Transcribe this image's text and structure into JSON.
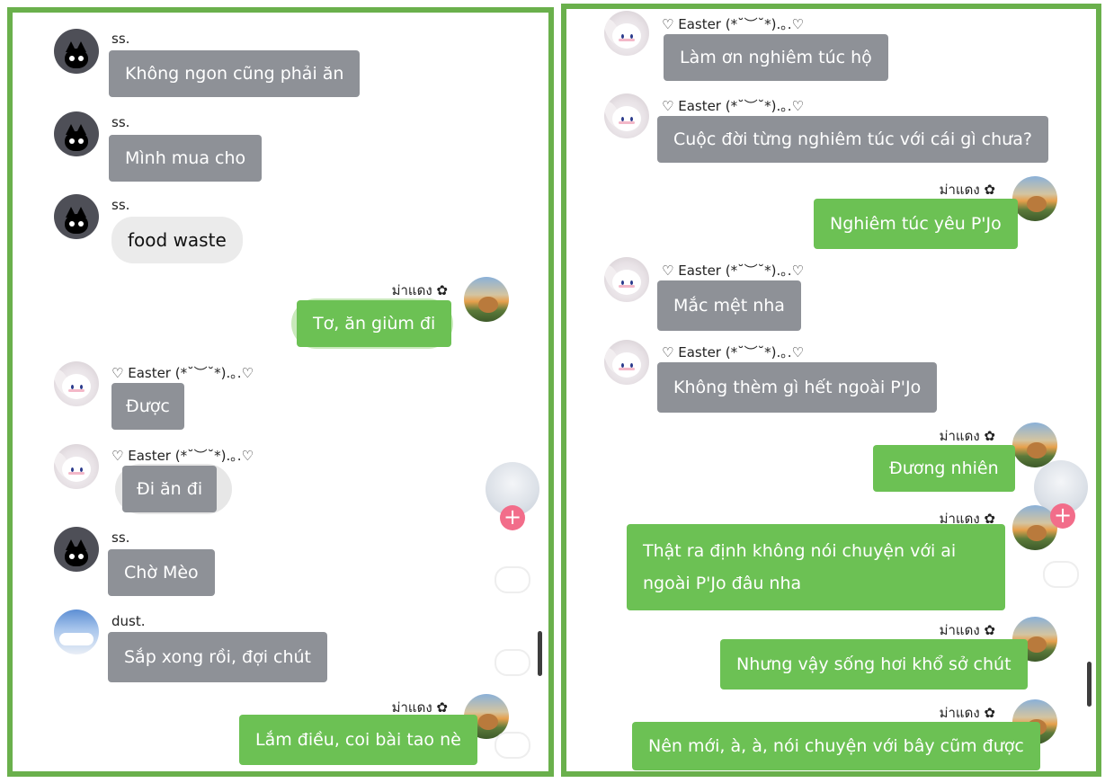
{
  "left": {
    "messages": [
      {
        "sender": "ss.",
        "text": "Không ngon cũng phải ăn"
      },
      {
        "sender": "ss.",
        "text": "Mình mua cho"
      },
      {
        "sender": "ss.",
        "text": "food waste"
      },
      {
        "sender": "ม่าแดง ✿",
        "text": "Tơ, ăn giùm đi"
      },
      {
        "sender": "♡ Easter (*˘︶˘*).｡.♡",
        "text": "Được"
      },
      {
        "sender": "♡ Easter (*˘︶˘*).｡.♡",
        "text": "Đi ăn đi"
      },
      {
        "sender": "ss.",
        "text": "Chờ Mèo"
      },
      {
        "sender": "dust.",
        "text": "Sắp xong rồi, đợi chút"
      },
      {
        "sender": "ม่าแดง ✿",
        "text": "Lắm điều, coi bài tao nè"
      }
    ],
    "plus": "+"
  },
  "right": {
    "messages": [
      {
        "sender": "♡ Easter (*˘︶˘*).｡.♡",
        "text": "Làm ơn nghiêm túc hộ"
      },
      {
        "sender": "♡ Easter (*˘︶˘*).｡.♡",
        "text": "Cuộc đời từng nghiêm túc với cái gì chưa?"
      },
      {
        "sender": "ม่าแดง ✿",
        "text": "Nghiêm túc yêu P'Jo"
      },
      {
        "sender": "♡ Easter (*˘︶˘*).｡.♡",
        "text": "Mắc mệt nha"
      },
      {
        "sender": "♡ Easter (*˘︶˘*).｡.♡",
        "text": "Không thèm gì hết ngoài P'Jo"
      },
      {
        "sender": "ม่าแดง ✿",
        "text": "Đương nhiên"
      },
      {
        "sender": "ม่าแดง ✿",
        "text": "Thật ra định không nói chuyện với ai ngoài P'Jo đâu nha"
      },
      {
        "sender": "ม่าแดง ✿",
        "text": "Nhưng vậy sống hơi khổ sở chút"
      },
      {
        "sender": "ม่าแดง ✿",
        "text": "Nên mới, à, à, nói chuyện với bây cũm được"
      }
    ],
    "plus": "+"
  },
  "colors": {
    "frame_green": "#6ab04c",
    "bubble_gray": "#8e9197",
    "bubble_green": "#6cc154",
    "bubble_light": "#ebebeb",
    "plus_badge": "#f26d8a"
  }
}
